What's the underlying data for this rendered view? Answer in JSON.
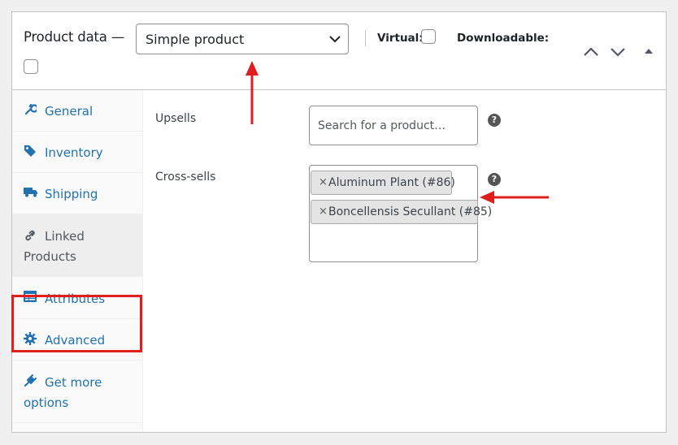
{
  "header": {
    "title": "Product data —",
    "product_type": "Simple product",
    "virtual_label": "Virtual:",
    "downloadable_label": "Downloadable:"
  },
  "tabs": [
    {
      "label": "General",
      "icon": "wrench-icon"
    },
    {
      "label": "Inventory",
      "icon": "tag-icon"
    },
    {
      "label": "Shipping",
      "icon": "truck-icon"
    },
    {
      "label_line1": "Linked",
      "label_line2": "Products",
      "icon": "link-icon",
      "active": true
    },
    {
      "label": "Attributes",
      "icon": "list-icon"
    },
    {
      "label": "Advanced",
      "icon": "gear-icon"
    },
    {
      "label_line1": "Get more",
      "label_line2": "options",
      "icon": "plugin-icon"
    }
  ],
  "fields": {
    "upsells": {
      "label": "Upsells",
      "placeholder": "Search for a product…"
    },
    "cross_sells": {
      "label": "Cross-sells",
      "selected": [
        "Aluminum Plant (#86)",
        "Boncellensis Secullant (#85)"
      ],
      "remove_symbol": "×"
    },
    "help_symbol": "?"
  },
  "colors": {
    "link": "#2271b1",
    "highlight": "#e01e1e",
    "border": "#c3c4c7"
  }
}
